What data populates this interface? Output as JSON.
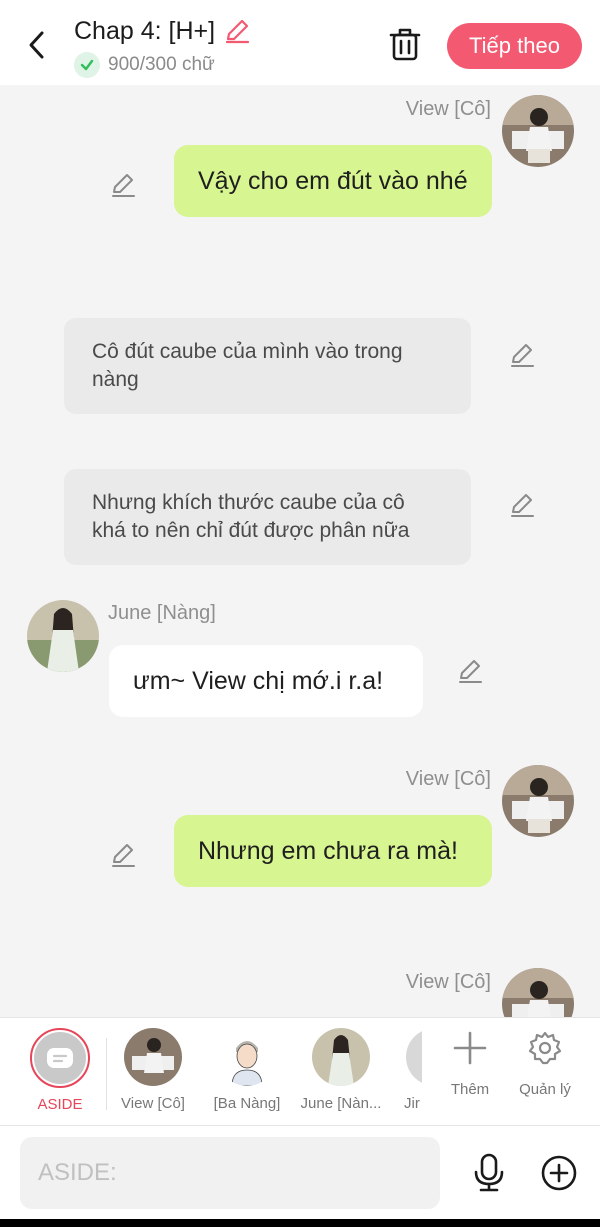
{
  "header": {
    "title": "Chap 4: [H+]",
    "word_count": "900/300 chữ",
    "next_label": "Tiếp theo"
  },
  "messages": [
    {
      "type": "me",
      "sender": "View [Cô]",
      "text": "Vậy cho em đút vào nhé"
    },
    {
      "type": "narration",
      "text": "Cô đút caube của mình vào trong nàng"
    },
    {
      "type": "narration",
      "text": "Nhưng khích thước caube của cô khá to nên chỉ đút được phân nữa"
    },
    {
      "type": "other",
      "sender": "June [Nàng]",
      "text": "ưm~ View chị mớ.i r.a!"
    },
    {
      "type": "me",
      "sender": "View [Cô]",
      "text": "Nhưng em chưa ra mà!"
    },
    {
      "type": "me",
      "sender": "View [Cô]",
      "text": ""
    }
  ],
  "characters": [
    {
      "label": "ASIDE",
      "active": true
    },
    {
      "label": "View [Cô]"
    },
    {
      "label": "[Ba Nàng]"
    },
    {
      "label": "June [Nàn..."
    },
    {
      "label": "Jir"
    }
  ],
  "tools": {
    "add_label": "Thêm",
    "manage_label": "Quản lý"
  },
  "input": {
    "placeholder": "ASIDE:"
  },
  "colors": {
    "accent": "#f35a72",
    "my_bubble": "#d7f590",
    "narration_bubble": "#eaeaea",
    "other_bubble": "#ffffff",
    "check_green": "#2fbf5a"
  }
}
